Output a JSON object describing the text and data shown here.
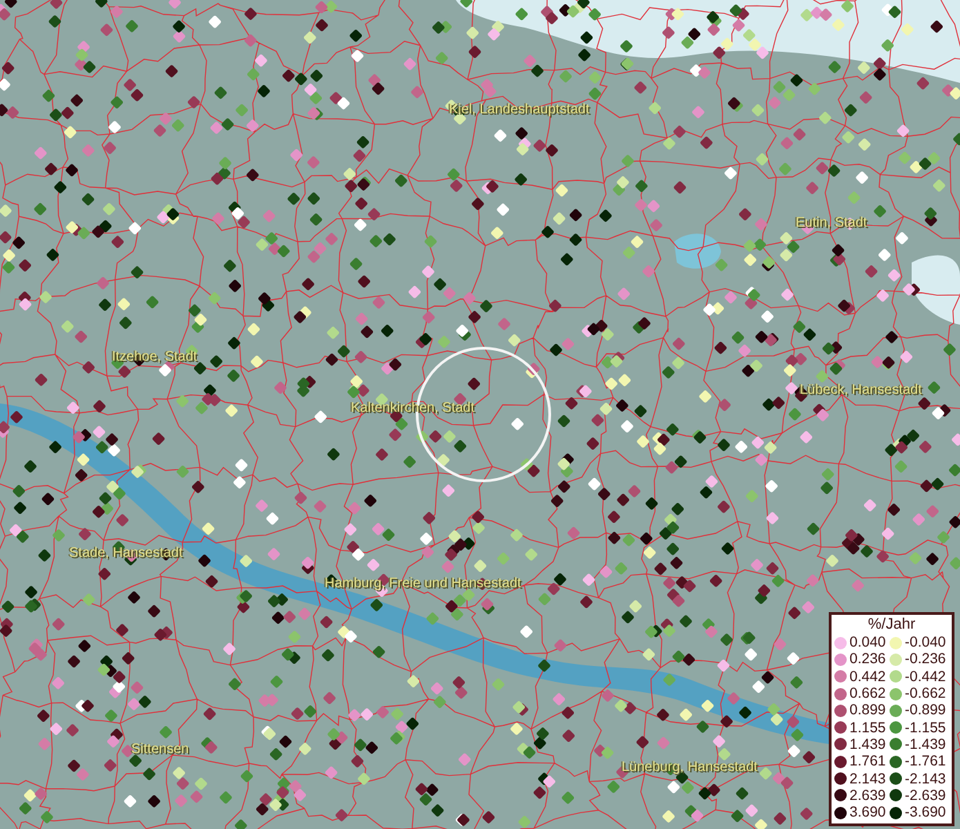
{
  "map": {
    "places": [
      {
        "name": "Kiel, Landeshauptstadt"
      },
      {
        "name": "Eutin, Stadt"
      },
      {
        "name": "Itzehoe, Stadt"
      },
      {
        "name": "Kaltenkirchen, Stadt"
      },
      {
        "name": "Lübeck, Hansestadt"
      },
      {
        "name": "Stade, Hansestadt"
      },
      {
        "name": "Hamburg, Freie und Hansestadt"
      },
      {
        "name": "Sittensen"
      },
      {
        "name": "Lüneburg, Hansestadt"
      }
    ]
  },
  "legend": {
    "title": "%/Jahr",
    "positive": [
      {
        "label": "0.040",
        "color": "#f6bce8"
      },
      {
        "label": "0.236",
        "color": "#e494c8"
      },
      {
        "label": "0.442",
        "color": "#d47ca6"
      },
      {
        "label": "0.662",
        "color": "#c2658a"
      },
      {
        "label": "0.899",
        "color": "#ae5070"
      },
      {
        "label": "1.155",
        "color": "#983a56"
      },
      {
        "label": "1.439",
        "color": "#822a42"
      },
      {
        "label": "1.761",
        "color": "#6a1a2e"
      },
      {
        "label": "2.143",
        "color": "#50101e"
      },
      {
        "label": "2.639",
        "color": "#380a14"
      },
      {
        "label": "3.690",
        "color": "#20040a"
      }
    ],
    "negative": [
      {
        "label": "-0.040",
        "color": "#f2f6b0"
      },
      {
        "label": "-0.236",
        "color": "#d6eaa8"
      },
      {
        "label": "-0.442",
        "color": "#b2da8c"
      },
      {
        "label": "-0.662",
        "color": "#8cc46c"
      },
      {
        "label": "-0.899",
        "color": "#6aac56"
      },
      {
        "label": "-1.155",
        "color": "#4c9640"
      },
      {
        "label": "-1.439",
        "color": "#3a7e30"
      },
      {
        "label": "-1.761",
        "color": "#2a6624"
      },
      {
        "label": "-2.143",
        "color": "#1c4e18"
      },
      {
        "label": "-2.639",
        "color": "#10380e"
      },
      {
        "label": "-3.690",
        "color": "#062406"
      }
    ]
  }
}
